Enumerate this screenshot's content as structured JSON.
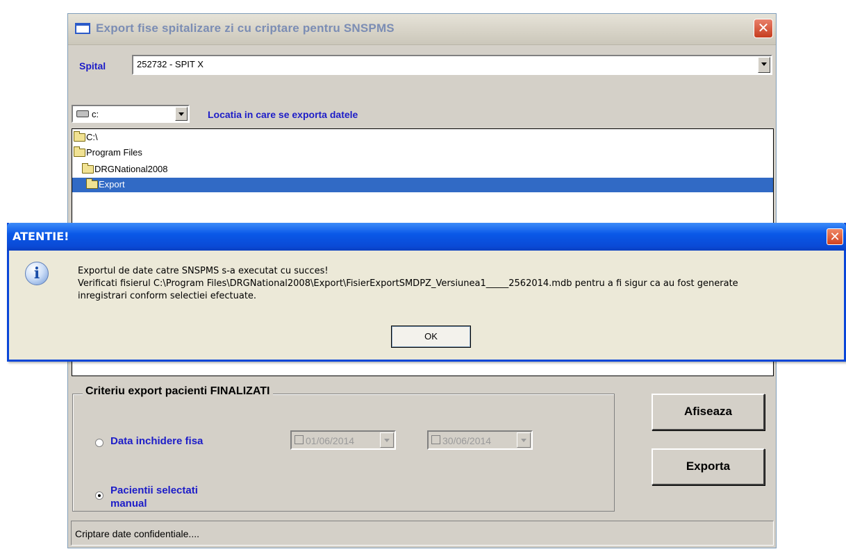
{
  "window": {
    "title": "Export fise spitalizare zi cu criptare pentru SNSPMS",
    "close_symbol": "✕",
    "icon": "window-icon"
  },
  "hospital": {
    "label": "Spital",
    "value": "252732 - SPIT X"
  },
  "drive": {
    "value": "c:",
    "icon": "drive-icon"
  },
  "location_label": "Locatia in care se exporta datele",
  "folders": [
    {
      "name": "C:\\"
    },
    {
      "name": "Program Files"
    },
    {
      "name": "DRGNational2008"
    },
    {
      "name": "Export",
      "selected": true
    }
  ],
  "criteria": {
    "title": "Criteriu export pacienti FINALIZATI",
    "option_close_date": "Data inchidere fisa",
    "option_manual_line1": "Pacientii selectati",
    "option_manual_line2": "manual",
    "selected_option": "manual",
    "date_from": "01/06/2014",
    "date_to": "30/06/2014"
  },
  "buttons": {
    "show": "Afiseaza",
    "export": "Exporta"
  },
  "status_bar": "Criptare date confidentiale....",
  "dialog": {
    "title": "ATENTIE!",
    "close_symbol": "✕",
    "icon": "info-icon",
    "icon_glyph": "i",
    "line1": "Exportul de date catre SNSPMS s-a executat cu succes!",
    "line2": "Verificati fisierul C:\\Program Files\\DRGNational2008\\Export\\FisierExportSMDPZ_Versiunea1_____2562014.mdb pentru a fi sigur ca au fost generate",
    "line3": "inregistrari conform selectiei efectuate.",
    "ok": "OK"
  },
  "colors": {
    "label_blue": "#1c1cc8",
    "selection": "#316ac5",
    "dialog_title": "#0a58e8",
    "window_face": "#d4d0c8"
  }
}
